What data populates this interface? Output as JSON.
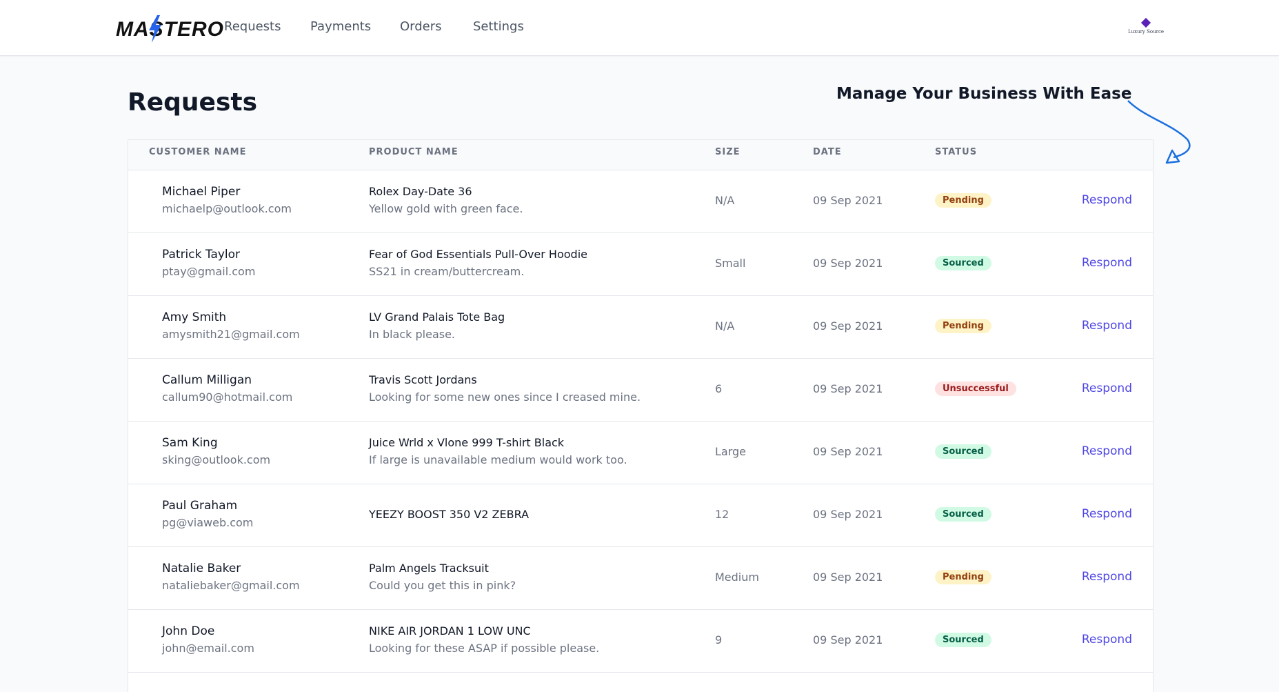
{
  "header": {
    "logo_text": "MASTERO",
    "nav": [
      "Requests",
      "Payments",
      "Orders",
      "Settings"
    ],
    "account_badge_text": "Luxury Source"
  },
  "page": {
    "title": "Requests",
    "tagline": "Manage Your Business With Ease"
  },
  "table": {
    "headers": [
      "CUSTOMER NAME",
      "PRODUCT NAME",
      "SIZE",
      "DATE",
      "STATUS"
    ],
    "action_label": "Respond",
    "rows": [
      {
        "name": "Michael Piper",
        "email": "michaelp@outlook.com",
        "product": "Rolex Day-Date 36",
        "note": "Yellow gold with green face.",
        "size": "N/A",
        "date": "09 Sep 2021",
        "status": "Pending",
        "status_kind": "pending"
      },
      {
        "name": "Patrick Taylor",
        "email": "ptay@gmail.com",
        "product": "Fear of God Essentials Pull-Over Hoodie",
        "note": "SS21 in cream/buttercream.",
        "size": "Small",
        "date": "09 Sep 2021",
        "status": "Sourced",
        "status_kind": "sourced"
      },
      {
        "name": "Amy Smith",
        "email": "amysmith21@gmail.com",
        "product": "LV Grand Palais Tote Bag",
        "note": "In black please.",
        "size": "N/A",
        "date": "09 Sep 2021",
        "status": "Pending",
        "status_kind": "pending"
      },
      {
        "name": "Callum Milligan",
        "email": "callum90@hotmail.com",
        "product": "Travis Scott Jordans",
        "note": "Looking for some new ones since I creased mine.",
        "size": "6",
        "date": "09 Sep 2021",
        "status": "Unsuccessful",
        "status_kind": "unsuccessful"
      },
      {
        "name": "Sam King",
        "email": "sking@outlook.com",
        "product": "Juice Wrld x Vlone 999 T-shirt Black",
        "note": "If large is unavailable medium would work too.",
        "size": "Large",
        "date": "09 Sep 2021",
        "status": "Sourced",
        "status_kind": "sourced"
      },
      {
        "name": "Paul Graham",
        "email": "pg@viaweb.com",
        "product": "YEEZY BOOST 350 V2 ZEBRA",
        "note": "",
        "size": "12",
        "date": "09 Sep 2021",
        "status": "Sourced",
        "status_kind": "sourced"
      },
      {
        "name": "Natalie Baker",
        "email": "nataliebaker@gmail.com",
        "product": "Palm Angels Tracksuit",
        "note": "Could you get this in pink?",
        "size": "Medium",
        "date": "09 Sep 2021",
        "status": "Pending",
        "status_kind": "pending"
      },
      {
        "name": "John Doe",
        "email": "john@email.com",
        "product": "NIKE AIR JORDAN 1 LOW UNC",
        "note": "Looking for these ASAP if possible please.",
        "size": "9",
        "date": "09 Sep 2021",
        "status": "Sourced",
        "status_kind": "sourced"
      }
    ]
  },
  "colors": {
    "accent": "#4f46e5",
    "arrow": "#1a6fe0",
    "pending_bg": "#fef3c7",
    "sourced_bg": "#d1fae5",
    "unsuccessful_bg": "#fee2e2"
  }
}
